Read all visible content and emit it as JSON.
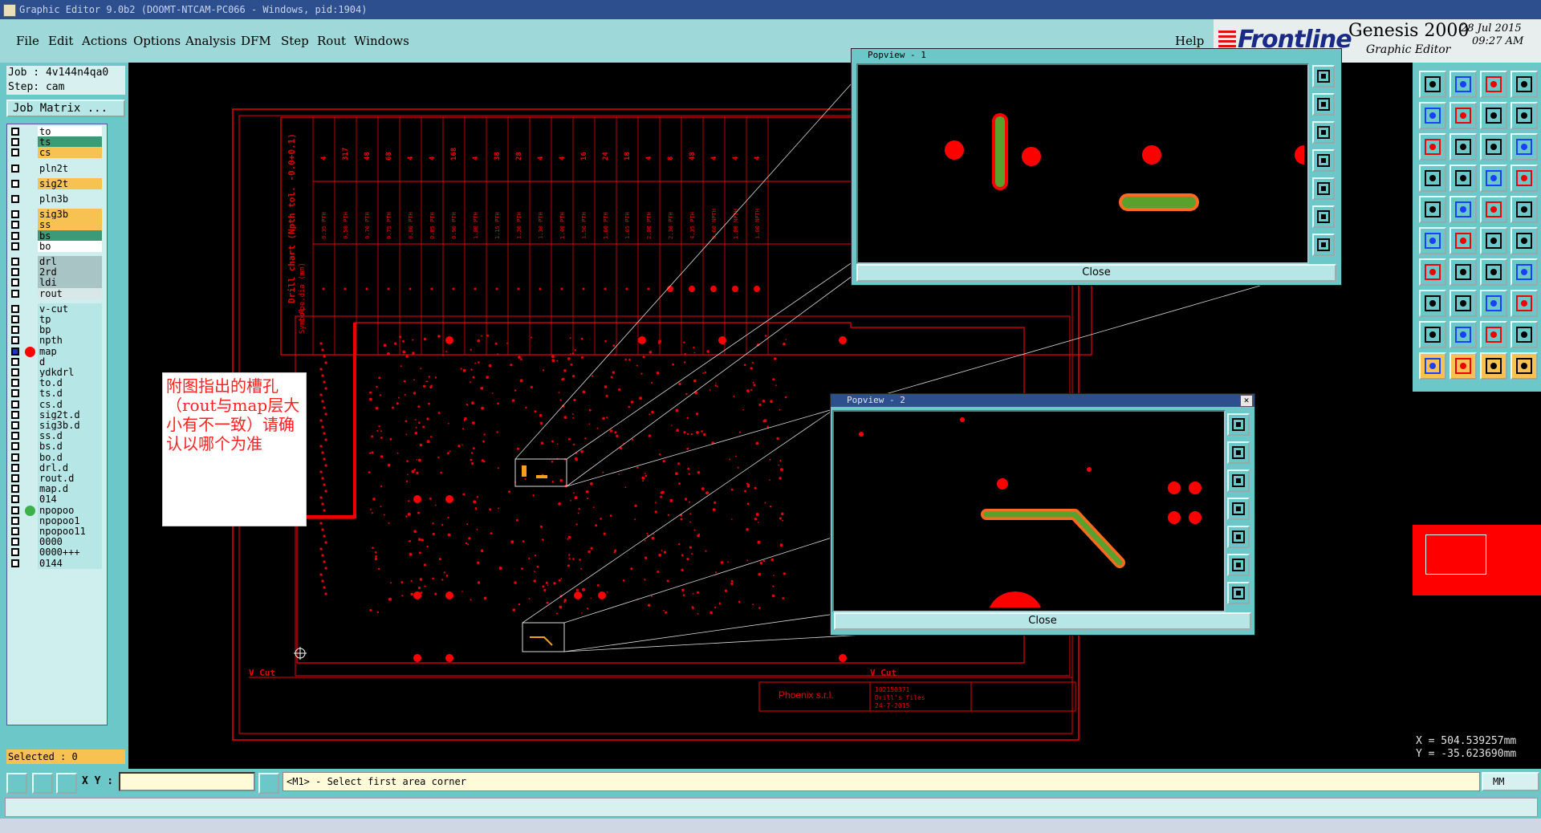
{
  "window": {
    "title": "Graphic Editor 9.0b2 (DOOMT-NTCAM-PC066 - Windows, pid:1904)"
  },
  "menu": [
    "File",
    "Edit",
    "Actions",
    "Options",
    "Analysis",
    "DFM",
    "Step",
    "Rout",
    "Windows"
  ],
  "help_label": "Help",
  "brand": {
    "logo": "Frontline",
    "product": "Genesis 2000",
    "subtitle": "Graphic Editor",
    "date": "28 Jul 2015",
    "time": "09:27 AM"
  },
  "job": {
    "job_line": "Job : 4v144n4qa0",
    "step_line": "Step: cam",
    "matrix_button": "Job Matrix ..."
  },
  "layers": [
    {
      "name": "to",
      "color": "#ffffff"
    },
    {
      "name": "ts",
      "color": "#3c9a78"
    },
    {
      "name": "cs",
      "color": "#f7c251"
    },
    {
      "name": "pln2t",
      "color": "#cfeeee"
    },
    {
      "name": "sig2t",
      "color": "#f7c251"
    },
    {
      "name": "pln3b",
      "color": "#cfeeee"
    },
    {
      "name": "sig3b",
      "color": "#f7c251"
    },
    {
      "name": "ss",
      "color": "#f7c251"
    },
    {
      "name": "bs",
      "color": "#3c9a78"
    },
    {
      "name": "bo",
      "color": "#ffffff"
    },
    {
      "name": "drl",
      "color": "#a9c4c4"
    },
    {
      "name": "2rd",
      "color": "#a9c4c4"
    },
    {
      "name": "ldi",
      "color": "#a9c4c4"
    },
    {
      "name": "rout",
      "color": "#d8e8e8"
    },
    {
      "name": "v-cut",
      "color": "#b6e6e6"
    },
    {
      "name": "tp",
      "color": "#b6e6e6"
    },
    {
      "name": "bp",
      "color": "#b6e6e6"
    },
    {
      "name": "npth",
      "color": "#b6e6e6"
    },
    {
      "name": "map",
      "color": "#b6e6e6"
    },
    {
      "name": "d",
      "color": "#b6e6e6"
    },
    {
      "name": "ydkdrl",
      "color": "#b6e6e6"
    },
    {
      "name": "to.d",
      "color": "#b6e6e6"
    },
    {
      "name": "ts.d",
      "color": "#b6e6e6"
    },
    {
      "name": "cs.d",
      "color": "#b6e6e6"
    },
    {
      "name": "sig2t.d",
      "color": "#b6e6e6"
    },
    {
      "name": "sig3b.d",
      "color": "#b6e6e6"
    },
    {
      "name": "ss.d",
      "color": "#b6e6e6"
    },
    {
      "name": "bs.d",
      "color": "#b6e6e6"
    },
    {
      "name": "bo.d",
      "color": "#b6e6e6"
    },
    {
      "name": "drl.d",
      "color": "#b6e6e6"
    },
    {
      "name": "rout.d",
      "color": "#b6e6e6"
    },
    {
      "name": "map.d",
      "color": "#b6e6e6"
    },
    {
      "name": "014",
      "color": "#b6e6e6"
    },
    {
      "name": "npopoo",
      "color": "#b6e6e6"
    },
    {
      "name": "npopoo1",
      "color": "#b6e6e6"
    },
    {
      "name": "npopoo11",
      "color": "#b6e6e6"
    },
    {
      "name": "0000",
      "color": "#b6e6e6"
    },
    {
      "name": "0000+++",
      "color": "#b6e6e6"
    },
    {
      "name": "0144",
      "color": "#b6e6e6"
    }
  ],
  "selected_label": "Selected : 0",
  "popview1": {
    "title": "Popview - 1",
    "close_label": "Close"
  },
  "popview2": {
    "title": "Popview - 2",
    "close_label": "Close"
  },
  "annotation": "附图指出的槽孔（rout与map层大小有不一致）请确认以哪个为准",
  "drill_chart": {
    "title": "Drill chart (Npth tol. -0.0+0.1)",
    "row_labels": [
      "Symbol",
      "Ape.dia (mm)"
    ],
    "counts": [
      "4",
      "317",
      "48",
      "68",
      "4",
      "4",
      "168",
      "4",
      "38",
      "28",
      "4",
      "4",
      "16",
      "24",
      "18",
      "4",
      "8",
      "48",
      "4",
      "4",
      "4"
    ],
    "dias": [
      "0.35 PTH",
      "0.50 PTH",
      "0.70 PTH",
      "0.75 PTH",
      "0.80 PTH",
      "0.85 PTH",
      "0.90 PTH",
      "1.00 PTH",
      "1.15 PTH",
      "1.30 PTH",
      "1.30 PTH",
      "1.40 PTH",
      "1.50 PTH",
      "1.60 PTH",
      "1.65 PTH",
      "2.00 PTH",
      "2.30 PTH",
      "4.35 PTH",
      "0.60 NPTH",
      "1.00 NPTH",
      "1.60 NPTH"
    ]
  },
  "board": {
    "vcut_left": "V Cut",
    "vcut_right": "V Cut",
    "company": "Phoenix s.r.l.",
    "tb_lines": [
      "102150371",
      "Drill's files",
      "24-7-2015"
    ]
  },
  "coords": {
    "x": "X = 504.539257mm",
    "y": "Y = -35.623690mm"
  },
  "command": {
    "xy_label": "X Y :",
    "prompt": "<M1> - Select first area corner",
    "units": "MM"
  }
}
